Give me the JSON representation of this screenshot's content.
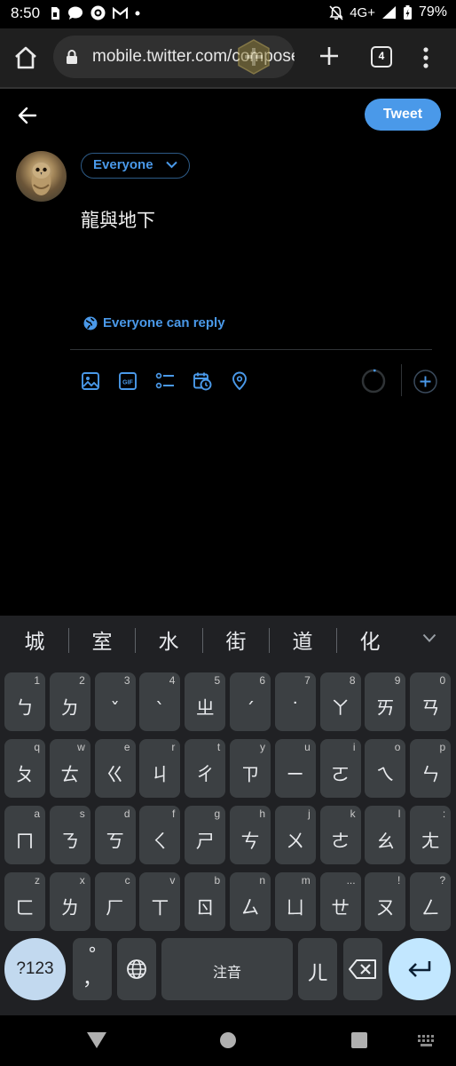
{
  "status_bar": {
    "time": "8:50",
    "network": "4G+",
    "battery": "79%",
    "left_icons": [
      "sim-icon",
      "chat-icon",
      "starbucks-icon",
      "gmail-icon",
      "dot-icon"
    ],
    "right_icons": [
      "mute-icon",
      "signal-icon",
      "battery-icon"
    ]
  },
  "browser": {
    "url": "mobile.twitter.com/compose/tweet",
    "tab_count": "4"
  },
  "compose": {
    "tweet_button": "Tweet",
    "audience": "Everyone",
    "text": "龍與地下",
    "reply_setting": "Everyone can reply",
    "accent_color": "#4a99e9"
  },
  "keyboard": {
    "suggestions": [
      "城",
      "室",
      "水",
      "街",
      "道",
      "化"
    ],
    "rows": [
      [
        {
          "hint": "1",
          "main": "ㄅ"
        },
        {
          "hint": "2",
          "main": "ㄉ"
        },
        {
          "hint": "3",
          "main": "ˇ"
        },
        {
          "hint": "4",
          "main": "ˋ"
        },
        {
          "hint": "5",
          "main": "ㄓ"
        },
        {
          "hint": "6",
          "main": "ˊ"
        },
        {
          "hint": "7",
          "main": "˙"
        },
        {
          "hint": "8",
          "main": "ㄚ"
        },
        {
          "hint": "9",
          "main": "ㄞ"
        },
        {
          "hint": "0",
          "main": "ㄢ"
        }
      ],
      [
        {
          "hint": "q",
          "main": "ㄆ"
        },
        {
          "hint": "w",
          "main": "ㄊ"
        },
        {
          "hint": "e",
          "main": "ㄍ"
        },
        {
          "hint": "r",
          "main": "ㄐ"
        },
        {
          "hint": "t",
          "main": "ㄔ"
        },
        {
          "hint": "y",
          "main": "ㄗ"
        },
        {
          "hint": "u",
          "main": "ㄧ"
        },
        {
          "hint": "i",
          "main": "ㄛ"
        },
        {
          "hint": "o",
          "main": "ㄟ"
        },
        {
          "hint": "p",
          "main": "ㄣ"
        }
      ],
      [
        {
          "hint": "a",
          "main": "ㄇ"
        },
        {
          "hint": "s",
          "main": "ㄋ"
        },
        {
          "hint": "d",
          "main": "ㄎ"
        },
        {
          "hint": "f",
          "main": "ㄑ"
        },
        {
          "hint": "g",
          "main": "ㄕ"
        },
        {
          "hint": "h",
          "main": "ㄘ"
        },
        {
          "hint": "j",
          "main": "ㄨ"
        },
        {
          "hint": "k",
          "main": "ㄜ"
        },
        {
          "hint": "l",
          "main": "ㄠ"
        },
        {
          "hint": ":",
          "main": "ㄤ"
        }
      ],
      [
        {
          "hint": "z",
          "main": "ㄈ"
        },
        {
          "hint": "x",
          "main": "ㄌ"
        },
        {
          "hint": "c",
          "main": "ㄏ"
        },
        {
          "hint": "v",
          "main": "ㄒ"
        },
        {
          "hint": "b",
          "main": "ㄖ"
        },
        {
          "hint": "n",
          "main": "ㄙ"
        },
        {
          "hint": "m",
          "main": "ㄩ"
        },
        {
          "hint": "...",
          "main": "ㄝ"
        },
        {
          "hint": "!",
          "main": "ㄡ"
        },
        {
          "hint": "?",
          "main": "ㄥ"
        }
      ]
    ],
    "symbols_key": "?123",
    "punct_top": "°",
    "punct_bottom": "，",
    "space_label": "注音",
    "er_key": "ㄦ"
  }
}
